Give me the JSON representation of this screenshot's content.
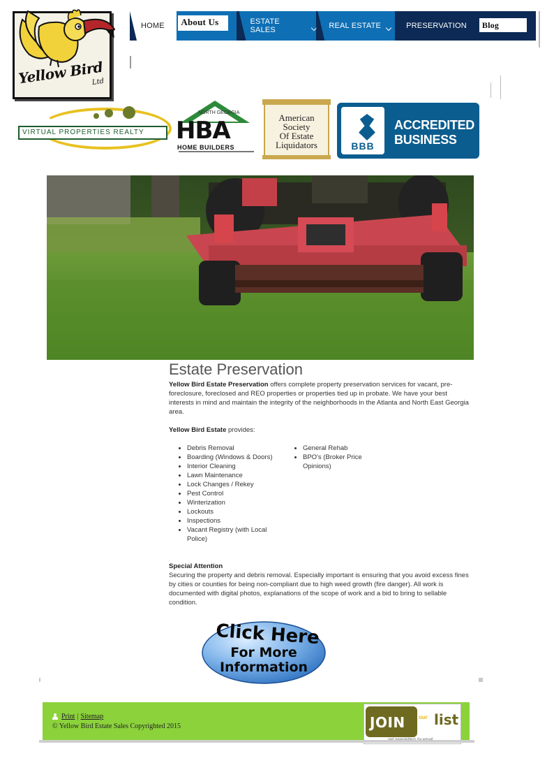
{
  "logo": {
    "text": "Yellow Bird",
    "ltd": "Ltd"
  },
  "nav": {
    "home": "HOME",
    "about": "About Us",
    "estate_sales": "ESTATE SALES",
    "real_estate": "REAL ESTATE",
    "preservation": "PRESERVATION",
    "blog": "Blog"
  },
  "badges": {
    "virtual": "VIRTUAL PROPERTIES REALTY",
    "hba_letters": "HBA",
    "hba_sub": "HOME BUILDERS",
    "hba_top": "NORTH GEORGIA",
    "asel": [
      "American",
      "Society",
      "Of Estate",
      "Liquidators"
    ],
    "bbb": "BBB",
    "bbb_accredited": "ACCREDITED",
    "bbb_business": "BUSINESS"
  },
  "content": {
    "heading": "Estate Preservation",
    "intro_brand": "Yellow Bird Estate Preservation",
    "intro_rest": " offers complete property preservation services for vacant, pre-foreclosure, foreclosed and REO properties or properties tied up in probate. We have your best interests in mind and maintain the integrity of the neighborhoods in the Atlanta and North East Georgia area.",
    "provides_brand": "Yellow Bird Estate",
    "provides_rest": " provides:",
    "list_left": [
      "Debris Removal",
      "Boarding (Windows & Doors)",
      "Interior Cleaning",
      "Lawn Maintenance",
      "Lock Changes / Rekey",
      "Pest Control",
      "Winterization",
      "Lockouts",
      "Inspections",
      "Vacant Registry (with Local Police)"
    ],
    "list_right": [
      "General Rehab",
      "BPO's (Broker Price Opinions)"
    ],
    "special_heading": "Special Attention",
    "special_text": "Securing the property and debris removal. Especially important is ensuring that you avoid excess fines by cities or counties for being non-compliant due to high weed growth (fire danger). All work is documented with digital photos, explanations of the scope of work and a bid to bring to sellable condition."
  },
  "cta": {
    "line1": "Click Here",
    "line2": "For More",
    "line3": "Information"
  },
  "footer": {
    "print": "Print",
    "separator": "|",
    "sitemap": "Sitemap",
    "copyright": "© Yellow Bird Estate Sales Copyrighted 2015",
    "join": "JOIN",
    "our": "our",
    "list": "list",
    "join_sub": "get newsletters by email"
  },
  "colors": {
    "nav_dark": "#0c2a55",
    "nav_blue": "#0f6fb5",
    "footer_green": "#8bd23b",
    "bbb_blue": "#0b5d8f"
  }
}
